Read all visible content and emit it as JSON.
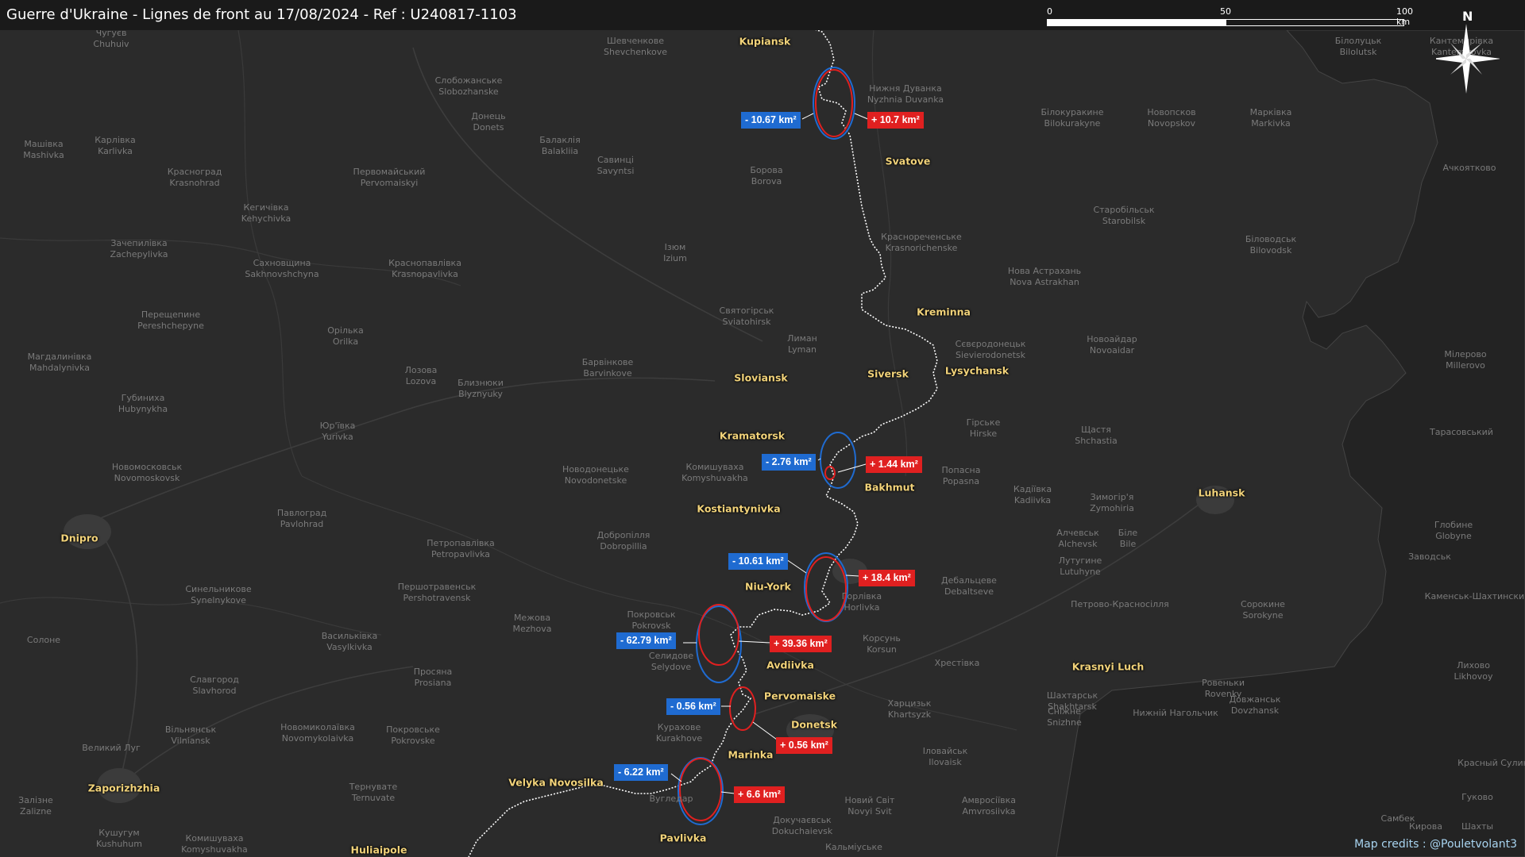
{
  "title": "Guerre d'Ukraine - Lignes de front au 17/08/2024 - Ref : U240817-1103",
  "scale": {
    "labels": [
      "0",
      "50",
      "100 km"
    ]
  },
  "compass": {
    "label": "N"
  },
  "credits": "Map credits : @Pouletvolant3",
  "colors": {
    "loss": "#1f6bd1",
    "gain": "#e02020",
    "city_label": "#f2d37a",
    "front_line": "#ffffff"
  },
  "cities": [
    "Kupiansk",
    "Svatove",
    "Kreminna",
    "Siversk",
    "Lysychansk",
    "Sloviansk",
    "Kramatorsk",
    "Bakhmut",
    "Kostiantynivka",
    "Niu-York",
    "Avdiivka",
    "Pervomaiske",
    "Donetsk",
    "Marinka",
    "Velyka Novosilka",
    "Pavlivka",
    "Huliaipole",
    "Zaporizhzhia",
    "Dnipro",
    "Luhansk",
    "Krasnyi Luch"
  ],
  "base_labels": [
    "Чугуєв Chuhuiv",
    "Шевченкове Shevchenkove",
    "Нижня Дуванка Nyzhnia Duvanka",
    "Білолуцьк Bilolutsk",
    "Кантемирівка Kantemirovka",
    "Слобожанське Slobozhanske",
    "Донець Donets",
    "Балаклія Balakliia",
    "Савинці Savyntsi",
    "Білокуракине Bilokurakyne",
    "Новопсков Novopskov",
    "Марківка Markivka",
    "Машівка Mashivka",
    "Карлівка Karlivka",
    "Красноград Krasnohrad",
    "Первомайський Pervomaiskyi",
    "Борова Borova",
    "Кегичівка Kehychivka",
    "Старобільськ Starobilsk",
    "Біловодськ Bilovodsk",
    "Зачепилівка Zachepylivka",
    "Ізюм Izium",
    "Краснореченське Krasnorichenske",
    "Сахновщина Sakhnovshchyna",
    "Краснопавлівка Krasnopavlivka",
    "Нова Астрахань Nova Astrakhan",
    "Перещепине Pereshchepyne",
    "Святогірськ Sviatohirsk",
    "Орілька Orilka",
    "Лиман Lyman",
    "Сєвєродонецьк Sievierodonetsk",
    "Новоайдар Novoaidar",
    "Магдалинівка Mahdalynivka",
    "Барвінкове Barvinkove",
    "Лозова Lozova",
    "Близнюки Blyznyuky",
    "Губиниха Hubynykha",
    "Юр'ївка Yurivka",
    "Гірське Hirske",
    "Щастя Shchastia",
    "Комишуваха Komyshuvakha",
    "Новомосковськ Novomoskovsk",
    "Новодонецьке Novodonetske",
    "Попасна Popasna",
    "Кадіївка Kadiivka",
    "Зимогір'я Zymohiria",
    "Павлоград Pavlohrad",
    "Петропавлівка Petropavlivka",
    "Добропілля Dobropillia",
    "Алчевськ Alchevsk",
    "Біле Bile",
    "Глобине Globyne",
    "Першотравенськ Pershotravensk",
    "Лутугине Lutuhyne",
    "Заводськ",
    "Синельникове Synelnykove",
    "Покровськ Pokrovsk",
    "Межова Mezhova",
    "Горлівка Horlivka",
    "Дебальцеве Debaltseve",
    "Петрово-Красносілля",
    "Сорокине Sorokyne",
    "Солоне",
    "Васильківка Vasylkivka",
    "Селидове Selydove",
    "Корсунь Korsun",
    "Хрестівка",
    "Просяна Prosiana",
    "Славгород Slavhorod",
    "Шахтарськ Shakhtarsk",
    "Ровеньки Rovenky",
    "Довжанськ Dovzhansk",
    "Вільнянськ Vilniansk",
    "Новомиколаївка Novomykolaivka",
    "Покровське Pokrovske",
    "Курахове Kurakhove",
    "Харцизьк Khartsyzk",
    "Сніжне Snizhne",
    "Нижній Нагольчик",
    "Великий Луг",
    "Іловайськ Ilovaisk",
    "Тернувате Ternuvate",
    "Вугледар",
    "Новий Світ Novyi Svit",
    "Амвросіївка Amvrosiivka",
    "Комишуваха Komyshuvakha",
    "Докучаєвськ Dokuchaievsk",
    "Кальміуське",
    "Кушугум Kushuhum",
    "Ачкоятково",
    "Мілерово Millerovo",
    "Тарасовський",
    "Каменськ-Шахтинский",
    "Лихово Likhovoy",
    "Красный Сулин",
    "Гуково",
    "Самбек",
    "Шахты",
    "Кирова",
    "Залізне Zalizne"
  ],
  "badges": [
    {
      "text": "- 10.67 km²",
      "type": "loss"
    },
    {
      "text": "+ 10.7 km²",
      "type": "gain"
    },
    {
      "text": "- 2.76 km²",
      "type": "loss"
    },
    {
      "text": "+ 1.44 km²",
      "type": "gain"
    },
    {
      "text": "- 10.61 km²",
      "type": "loss"
    },
    {
      "text": "+ 18.4 km²",
      "type": "gain"
    },
    {
      "text": "- 62.79 km²",
      "type": "loss"
    },
    {
      "text": "+ 39.36 km²",
      "type": "gain"
    },
    {
      "text": "- 0.56 km²",
      "type": "loss"
    },
    {
      "text": "+ 0.56 km²",
      "type": "gain"
    },
    {
      "text": "- 6.22 km²",
      "type": "loss"
    },
    {
      "text": "+ 6.6 km²",
      "type": "gain"
    }
  ]
}
